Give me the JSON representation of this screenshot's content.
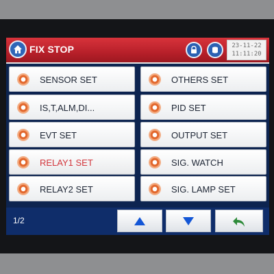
{
  "header": {
    "title": "FIX STOP",
    "date": "23-11-22",
    "time": "11:11:20"
  },
  "menu": {
    "left": [
      {
        "label": "SENSOR SET",
        "icon": "gear-icon"
      },
      {
        "label": "IS,T,ALM,DI...",
        "icon": "gear-icon"
      },
      {
        "label": "EVT  SET",
        "icon": "gear-icon"
      },
      {
        "label": "RELAY1  SET",
        "icon": "gear-icon",
        "color": "#d2343a"
      },
      {
        "label": "RELAY2  SET",
        "icon": "gear-icon"
      }
    ],
    "right": [
      {
        "label": "OTHERS SET",
        "icon": "gear-icon"
      },
      {
        "label": "PID SET",
        "icon": "gear-icon"
      },
      {
        "label": "OUTPUT SET",
        "icon": "gear-icon"
      },
      {
        "label": "SIG. WATCH",
        "icon": "gear-icon"
      },
      {
        "label": "SIG. LAMP SET",
        "icon": "gear-icon"
      }
    ]
  },
  "footer": {
    "page": "1/2"
  },
  "colors": {
    "header_red": "#c42730",
    "screen_blue": "#0d2450",
    "accent_blue": "#1356d6",
    "highlight_red": "#d2343a"
  }
}
